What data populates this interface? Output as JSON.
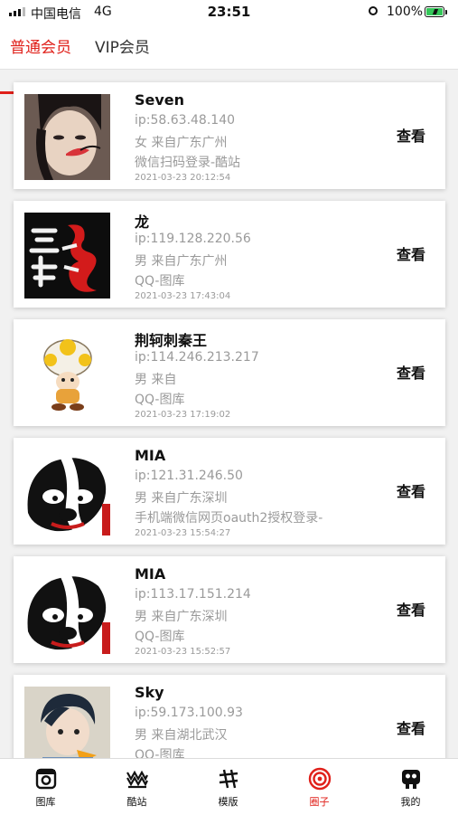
{
  "status_bar": {
    "carrier": "中国电信",
    "network": "4G",
    "time": "23:51",
    "battery": "100%"
  },
  "tabs": [
    {
      "label": "普通会员",
      "active": true
    },
    {
      "label": "VIP会员",
      "active": false
    }
  ],
  "members": [
    {
      "name": "Seven",
      "ip": "ip:58.63.48.140",
      "info": "女  来自广东广州",
      "source": "微信扫码登录-酷站",
      "date": "2021-03-23 20:12:54",
      "avatar": "girl-portrait-avatar"
    },
    {
      "name": "龙",
      "ip": "ip:119.128.220.56",
      "info": "男  来自广东广州",
      "source": "QQ-图库",
      "date": "2021-03-23 17:43:04",
      "avatar": "calligraphy-dragon-avatar"
    },
    {
      "name": "荆轲刺秦王",
      "ip": "ip:114.246.213.217",
      "info": "男  来自",
      "source": "QQ-图库",
      "date": "2021-03-23 17:19:02",
      "avatar": "mushroom-character-avatar"
    },
    {
      "name": "MIA",
      "ip": "ip:121.31.246.50",
      "info": "男  来自广东深圳",
      "source": "手机端微信网页oauth2授权登录-",
      "date": "2021-03-23 15:54:27",
      "avatar": "cartoon-skunk-avatar"
    },
    {
      "name": "MIA",
      "ip": "ip:113.17.151.214",
      "info": "男  来自广东深圳",
      "source": "QQ-图库",
      "date": "2021-03-23 15:52:57",
      "avatar": "cartoon-skunk-avatar"
    },
    {
      "name": "Sky",
      "ip": "ip:59.173.100.93",
      "info": "男  来自湖北武汉",
      "source": "QQ-图库",
      "date": "",
      "avatar": "anime-boy-avatar"
    }
  ],
  "view_label": "查看",
  "tabbar": [
    {
      "label": "图库",
      "icon": "instagram-icon",
      "active": false
    },
    {
      "label": "酷站",
      "icon": "wave-logo-icon",
      "active": false
    },
    {
      "label": "模版",
      "icon": "grid-hash-icon",
      "active": false
    },
    {
      "label": "圈子",
      "icon": "target-icon",
      "active": true
    },
    {
      "label": "我的",
      "icon": "profile-icon",
      "active": false
    }
  ],
  "colors": {
    "accent": "#e0201a",
    "muted_text": "#9a9a9a",
    "battery": "#34c759"
  }
}
